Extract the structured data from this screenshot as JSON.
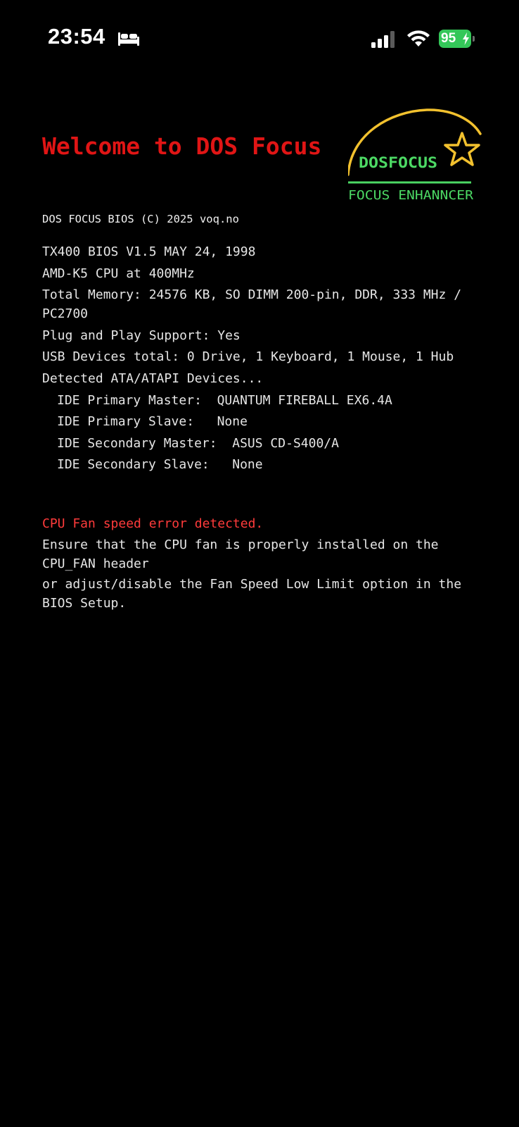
{
  "status_bar": {
    "time": "23:54",
    "battery_percent": "95",
    "battery_color": "#34c759",
    "icons": [
      "bed-icon",
      "cellular-signal-icon",
      "wifi-icon",
      "battery-charging-icon"
    ]
  },
  "header": {
    "welcome": "Welcome to DOS Focus",
    "welcome_color": "#e01515"
  },
  "logo": {
    "name": "DOSFOCUS",
    "tagline": "FOCUS ENHANNCER",
    "text_color": "#4cd964",
    "arc_color": "#f2c12e"
  },
  "bios": {
    "copyright": "DOS FOCUS BIOS (C) 2025 voq.no",
    "lines": [
      "TX400 BIOS V1.5 MAY 24, 1998",
      "AMD-K5 CPU at 400MHz",
      "Total Memory: 24576 KB, SO DIMM 200-pin, DDR, 333 MHz / PC2700",
      "Plug and Play Support: Yes",
      "USB Devices total: 0 Drive, 1 Keyboard, 1 Mouse, 1 Hub",
      "Detected ATA/ATAPI Devices..."
    ],
    "devices": [
      "IDE Primary Master:  QUANTUM FIREBALL EX6.4A",
      "IDE Primary Slave:   None",
      "IDE Secondary Master:  ASUS CD-S400/A",
      "IDE Secondary Slave:   None"
    ]
  },
  "error": {
    "title": "CPU Fan speed error detected.",
    "title_color": "#ff3b3b",
    "message_1": "Ensure that the CPU fan is properly installed on the CPU_FAN header",
    "message_2": "or adjust/disable the Fan Speed Low Limit option in the BIOS Setup."
  }
}
